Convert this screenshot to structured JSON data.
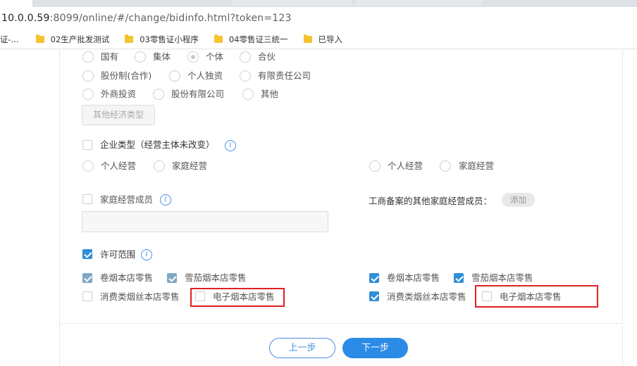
{
  "browser": {
    "url_host": "10.0.0.59",
    "url_rest": ":8099/online/#/change/bidinfo.html?token=123",
    "bookmarks": [
      "证-...",
      "02生产批发测试",
      "03零售证小程序",
      "04零售证三统一",
      "已导入"
    ]
  },
  "economy": {
    "row1": [
      "国有",
      "集体",
      "个体",
      "合伙"
    ],
    "row2": [
      "股份制(合作)",
      "个人独资",
      "有限责任公司"
    ],
    "row3": [
      "外商投资",
      "股份有限公司",
      "其他"
    ],
    "other_button": "其他经济类型"
  },
  "enterprise": {
    "label": "企业类型（经营主体未改变）",
    "left_options": [
      "个人经营",
      "家庭经营"
    ],
    "right_options": [
      "个人经营",
      "家庭经营"
    ]
  },
  "family": {
    "label": "家庭经营成员",
    "registered_label": "工商备案的其他家庭经营成员：",
    "add_button": "添加"
  },
  "license": {
    "label": "许可范围",
    "left": [
      "卷烟本店零售",
      "雪茄烟本店零售",
      "消费类烟丝本店零售",
      "电子烟本店零售"
    ],
    "right": [
      "卷烟本店零售",
      "雪茄烟本店零售",
      "消费类烟丝本店零售",
      "电子烟本店零售"
    ]
  },
  "info_glyph": "i",
  "nav": {
    "prev": "上一步",
    "next": "下一步"
  }
}
